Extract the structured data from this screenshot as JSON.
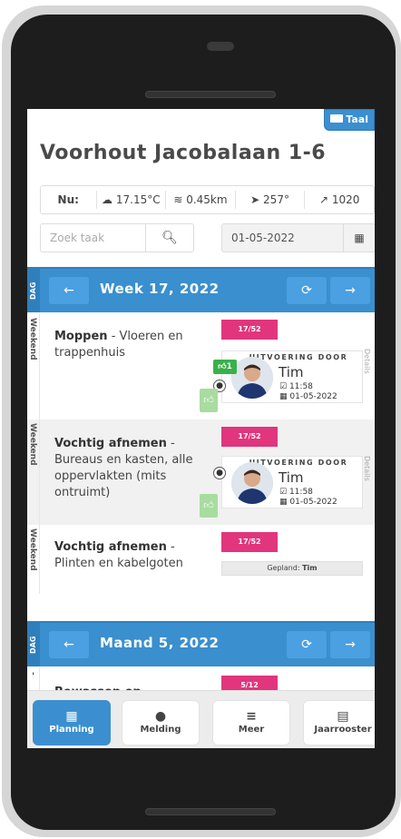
{
  "header": {
    "lang_label": "Taal",
    "title": "Voorhout Jacobalaan 1-6"
  },
  "weather": {
    "now_label": "Nu:",
    "temp": "17.15°C",
    "wind": "0.45km",
    "direction": "257°",
    "pressure": "1020"
  },
  "search": {
    "placeholder": "Zoek taak"
  },
  "date_filter": {
    "value": "01-05-2022"
  },
  "week_section": {
    "side_label": "DAG",
    "title": "Week 17, 2022",
    "prev": "←",
    "next": "→"
  },
  "tasks": [
    {
      "side": "Weekend",
      "name_bold": "Moppen",
      "name_rest": " - Vloeren en trappenhuis",
      "badge": "17/52",
      "header": "UITVOERING DOOR",
      "person": "Tim",
      "time": "11:58",
      "date": "01-05-2022",
      "likes": "1",
      "details": "Details"
    },
    {
      "side": "Weekend",
      "name_bold": "Vochtig afnemen",
      "name_rest": " - Bureaus en kasten, alle oppervlakten (mits ontruimt)",
      "badge": "17/52",
      "header": "UITVOERING DOOR",
      "person": "Tim",
      "time": "11:58",
      "date": "01-05-2022",
      "details": "Details"
    },
    {
      "side": "Weekend",
      "name_bold": "Vochtig afnemen",
      "name_rest": " - Plinten en kabelgoten",
      "badge": "17/52",
      "planned_label": "Gepland:",
      "planned_person": "Tim"
    }
  ],
  "month_section": {
    "side_label": "DAG",
    "title": "Maand 5, 2022",
    "prev": "←",
    "next": "→",
    "first_task": "Bewassen en",
    "first_badge": "5/12",
    "first_side": "-"
  },
  "tabs": [
    {
      "label": "Planning",
      "icon": "calendar-icon"
    },
    {
      "label": "Melding",
      "icon": "chat-icon"
    },
    {
      "label": "Meer",
      "icon": "menu-icon"
    },
    {
      "label": "Jaarrooster",
      "icon": "file-icon"
    }
  ],
  "colors": {
    "accent": "#3a8fce",
    "badge": "#e1357d",
    "like": "#3ab04a"
  }
}
